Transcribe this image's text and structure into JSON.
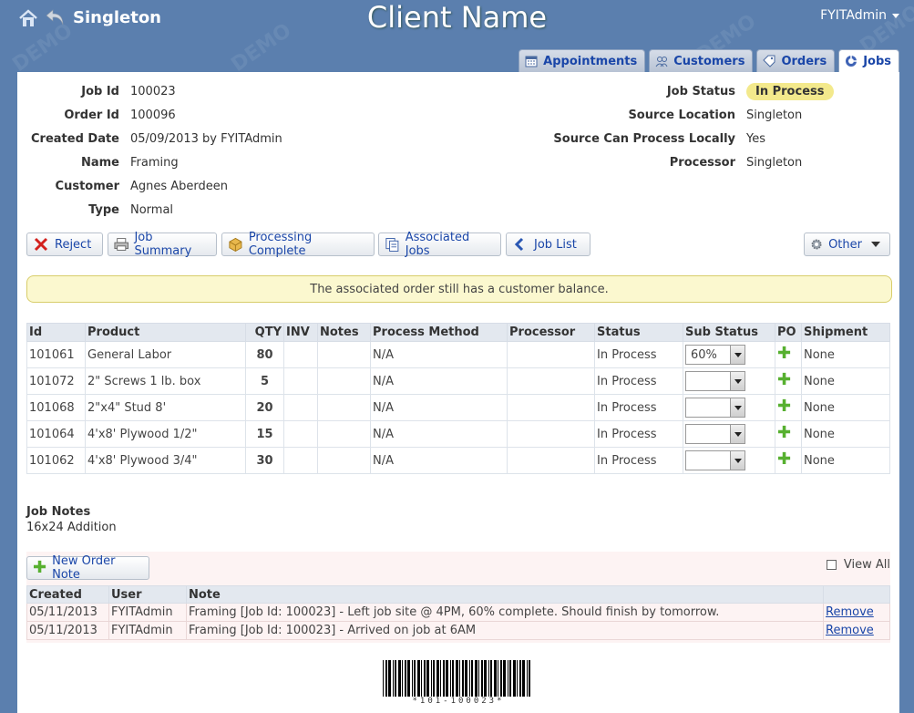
{
  "header": {
    "site_name": "Singleton",
    "app_title": "Client Name",
    "user": "FYITAdmin",
    "watermark": "DEMO"
  },
  "tabs": [
    {
      "label": "Appointments",
      "icon": "calendar-icon",
      "active": false
    },
    {
      "label": "Customers",
      "icon": "customers-icon",
      "active": false
    },
    {
      "label": "Orders",
      "icon": "tag-icon",
      "active": false
    },
    {
      "label": "Jobs",
      "icon": "jobs-icon",
      "active": true
    }
  ],
  "job_info": {
    "left": [
      {
        "label": "Job Id",
        "value": "100023"
      },
      {
        "label": "Order Id",
        "value": "100096"
      },
      {
        "label": "Created Date",
        "value": "05/09/2013 by FYITAdmin"
      },
      {
        "label": "Name",
        "value": "Framing"
      },
      {
        "label": "Customer",
        "value": "Agnes Aberdeen"
      },
      {
        "label": "Type",
        "value": "Normal"
      }
    ],
    "right": [
      {
        "label": "Job Status",
        "value": "In Process"
      },
      {
        "label": "Source Location",
        "value": "Singleton"
      },
      {
        "label": "Source Can Process Locally",
        "value": "Yes"
      },
      {
        "label": "Processor",
        "value": "Singleton"
      }
    ]
  },
  "actions": {
    "reject": "Reject",
    "job_summary": "Job Summary",
    "processing_complete": "Processing Complete",
    "associated_jobs": "Associated Jobs",
    "job_list": "Job List",
    "other": "Other"
  },
  "alert": "The associated order still has a customer balance.",
  "items_table": {
    "headers": [
      "Id",
      "Product",
      "QTY",
      "INV",
      "Notes",
      "Process Method",
      "Processor",
      "Status",
      "Sub Status",
      "PO",
      "Shipment"
    ],
    "rows": [
      {
        "id": "101061",
        "product": "General Labor",
        "qty": "80",
        "inv": "",
        "notes": "",
        "method": "N/A",
        "processor": "",
        "status": "In Process",
        "sub_status": "60%",
        "shipment": "None"
      },
      {
        "id": "101072",
        "product": "2\" Screws 1 lb. box",
        "qty": "5",
        "inv": "",
        "notes": "",
        "method": "N/A",
        "processor": "",
        "status": "In Process",
        "sub_status": "",
        "shipment": "None"
      },
      {
        "id": "101068",
        "product": "2\"x4\" Stud 8'",
        "qty": "20",
        "inv": "",
        "notes": "",
        "method": "N/A",
        "processor": "",
        "status": "In Process",
        "sub_status": "",
        "shipment": "None"
      },
      {
        "id": "101064",
        "product": "4'x8' Plywood 1/2\"",
        "qty": "15",
        "inv": "",
        "notes": "",
        "method": "N/A",
        "processor": "",
        "status": "In Process",
        "sub_status": "",
        "shipment": "None"
      },
      {
        "id": "101062",
        "product": "4'x8' Plywood 3/4\"",
        "qty": "30",
        "inv": "",
        "notes": "",
        "method": "N/A",
        "processor": "",
        "status": "In Process",
        "sub_status": "",
        "shipment": "None"
      }
    ]
  },
  "job_notes": {
    "title": "Job Notes",
    "text": "16x24 Addition"
  },
  "order_notes": {
    "new_button": "New Order Note",
    "view_all": "View All",
    "headers": [
      "Created",
      "User",
      "Note",
      ""
    ],
    "rows": [
      {
        "created": "05/11/2013",
        "user": "FYITAdmin",
        "note": "Framing [Job Id: 100023] - Left job site @ 4PM, 60% complete. Should finish by tomorrow.",
        "action": "Remove"
      },
      {
        "created": "05/11/2013",
        "user": "FYITAdmin",
        "note": "Framing [Job Id: 100023] - Arrived on job at 6AM",
        "action": "Remove"
      }
    ]
  },
  "barcode": {
    "text": "*101-100023*"
  },
  "colors": {
    "background": "#5b7fae",
    "link": "#1a46a8",
    "status_badge": "#f3e98c",
    "alert_bg": "#fbf8cf"
  }
}
